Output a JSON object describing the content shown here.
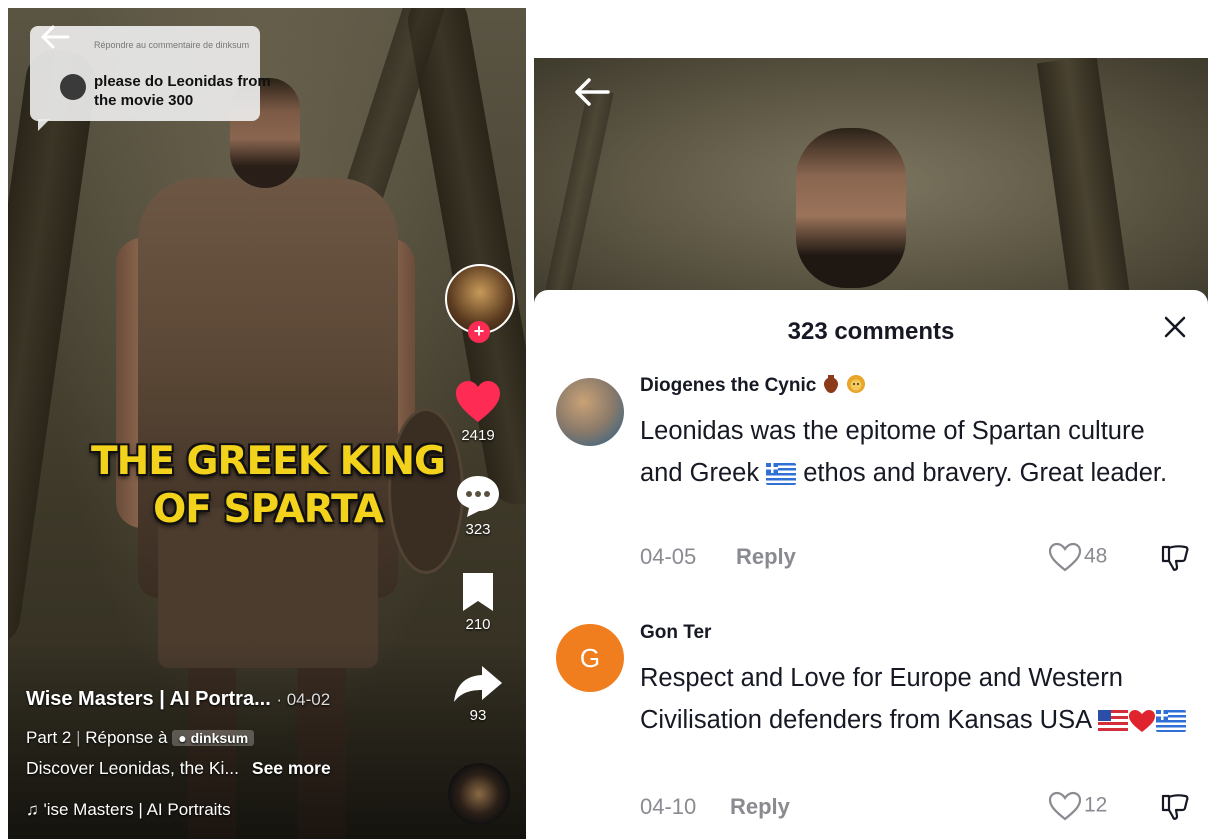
{
  "left_video": {
    "reply_meta": "Répondre au commentaire de dinksum",
    "reply_text": "please do Leonidas from the movie 300",
    "overlay_line1": "THE GREEK KING",
    "overlay_line2": "OF SPARTA",
    "likes": "2419",
    "comments": "323",
    "saves": "210",
    "shares": "93",
    "author": "Wise Masters | AI Portra...",
    "date": "· 04-02",
    "desc_prefix": "Part 2",
    "desc_reply": "Réponse à",
    "desc_tag": "dinksum",
    "desc_text": "Discover Leonidas, the Ki...",
    "see_more": "See more",
    "music": "'ise Masters | AI Portraits",
    "colors": {
      "like": "#fe2c55",
      "overlay": "#f3d21b"
    }
  },
  "comments_sheet": {
    "title": "323 comments",
    "items": [
      {
        "name": "Diogenes the Cynic",
        "text_parts": [
          "Leonidas was the epitome of Spartan culture and Greek ",
          " ethos and bravery. Great leader."
        ],
        "date": "04-05",
        "reply": "Reply",
        "likes": "48"
      },
      {
        "name": "Gon Ter",
        "avatar_letter": "G",
        "text": "Respect and Love for Europe and Western Civilisation defenders from Kansas USA ",
        "date": "04-10",
        "reply": "Reply",
        "likes": "12"
      }
    ]
  }
}
